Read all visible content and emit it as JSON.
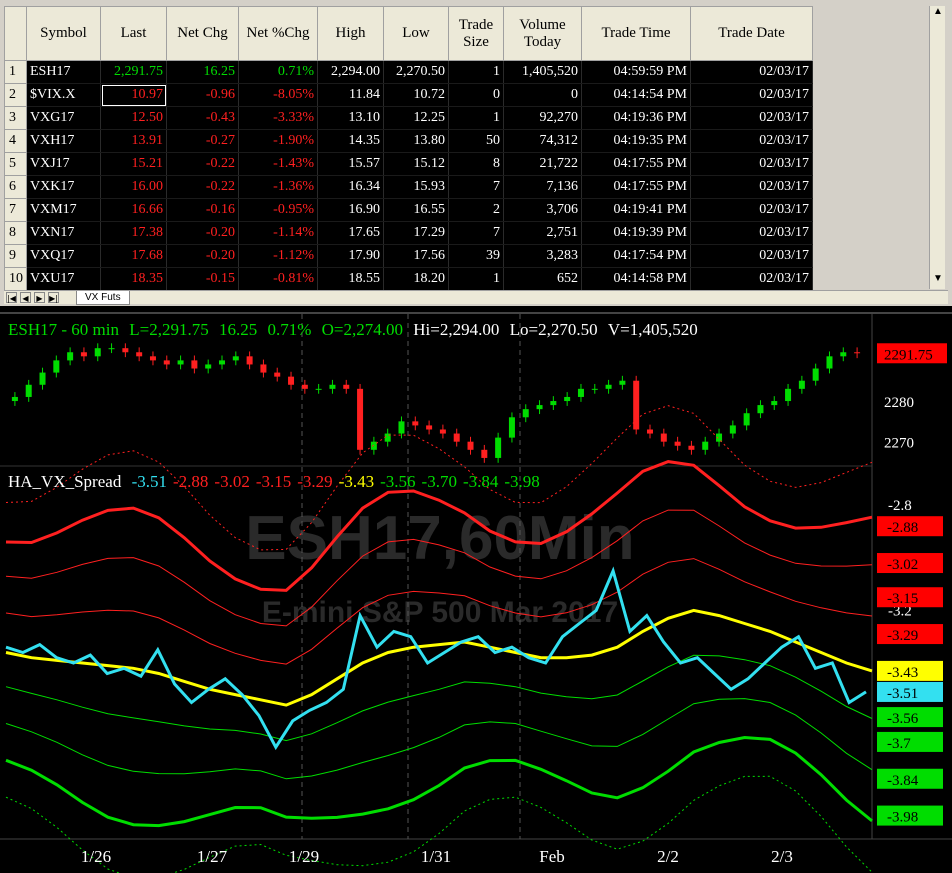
{
  "quote": {
    "headers": [
      "Symbol",
      "Last",
      "Net Chg",
      "Net %Chg",
      "High",
      "Low",
      "Trade Size",
      "Volume Today",
      "Trade Time",
      "Trade Date"
    ],
    "rows": [
      {
        "n": "1",
        "symbol": "ESH17",
        "last": "2,291.75",
        "chg": "16.25",
        "pct": "0.71%",
        "high": "2,294.00",
        "low": "2,270.50",
        "size": "1",
        "volume": "1,405,520",
        "time": "04:59:59 PM",
        "date": "02/03/17",
        "dir": "up"
      },
      {
        "n": "2",
        "symbol": "$VIX.X",
        "last": "10.97",
        "chg": "-0.96",
        "pct": "-8.05%",
        "high": "11.84",
        "low": "10.72",
        "size": "0",
        "volume": "0",
        "time": "04:14:54 PM",
        "date": "02/03/17",
        "dir": "dn"
      },
      {
        "n": "3",
        "symbol": "VXG17",
        "last": "12.50",
        "chg": "-0.43",
        "pct": "-3.33%",
        "high": "13.10",
        "low": "12.25",
        "size": "1",
        "volume": "92,270",
        "time": "04:19:36 PM",
        "date": "02/03/17",
        "dir": "dn"
      },
      {
        "n": "4",
        "symbol": "VXH17",
        "last": "13.91",
        "chg": "-0.27",
        "pct": "-1.90%",
        "high": "14.35",
        "low": "13.80",
        "size": "50",
        "volume": "74,312",
        "time": "04:19:35 PM",
        "date": "02/03/17",
        "dir": "dn"
      },
      {
        "n": "5",
        "symbol": "VXJ17",
        "last": "15.21",
        "chg": "-0.22",
        "pct": "-1.43%",
        "high": "15.57",
        "low": "15.12",
        "size": "8",
        "volume": "21,722",
        "time": "04:17:55 PM",
        "date": "02/03/17",
        "dir": "dn"
      },
      {
        "n": "6",
        "symbol": "VXK17",
        "last": "16.00",
        "chg": "-0.22",
        "pct": "-1.36%",
        "high": "16.34",
        "low": "15.93",
        "size": "7",
        "volume": "7,136",
        "time": "04:17:55 PM",
        "date": "02/03/17",
        "dir": "dn"
      },
      {
        "n": "7",
        "symbol": "VXM17",
        "last": "16.66",
        "chg": "-0.16",
        "pct": "-0.95%",
        "high": "16.90",
        "low": "16.55",
        "size": "2",
        "volume": "3,706",
        "time": "04:19:41 PM",
        "date": "02/03/17",
        "dir": "dn"
      },
      {
        "n": "8",
        "symbol": "VXN17",
        "last": "17.38",
        "chg": "-0.20",
        "pct": "-1.14%",
        "high": "17.65",
        "low": "17.29",
        "size": "7",
        "volume": "2,751",
        "time": "04:19:39 PM",
        "date": "02/03/17",
        "dir": "dn"
      },
      {
        "n": "9",
        "symbol": "VXQ17",
        "last": "17.68",
        "chg": "-0.20",
        "pct": "-1.12%",
        "high": "17.90",
        "low": "17.56",
        "size": "39",
        "volume": "3,283",
        "time": "04:17:54 PM",
        "date": "02/03/17",
        "dir": "dn"
      },
      {
        "n": "10",
        "symbol": "VXU17",
        "last": "18.35",
        "chg": "-0.15",
        "pct": "-0.81%",
        "high": "18.55",
        "low": "18.20",
        "size": "1",
        "volume": "652",
        "time": "04:14:58 PM",
        "date": "02/03/17",
        "dir": "dn"
      }
    ],
    "sheet_tab": "VX Futs",
    "nav_buttons": [
      "|◀",
      "◀",
      "▶",
      "▶|"
    ]
  },
  "chart_header": {
    "symbol": "ESH17 - 60 min",
    "last": "L=2,291.75",
    "chg": "16.25",
    "pct": "0.71%",
    "open": "O=2,274.00",
    "hi": "Hi=2,294.00",
    "lo": "Lo=2,270.50",
    "vol": "V=1,405,520"
  },
  "indicator_header": {
    "name": "HA_VX_Spread",
    "values": [
      {
        "text": "-3.51",
        "color": "#33e0f0"
      },
      {
        "text": "-2.88",
        "color": "#ff2020"
      },
      {
        "text": "-3.02",
        "color": "#ff2020"
      },
      {
        "text": "-3.15",
        "color": "#ff2020"
      },
      {
        "text": "-3.29",
        "color": "#ff2020"
      },
      {
        "text": "-3.43",
        "color": "#ffff00"
      },
      {
        "text": "-3.56",
        "color": "#00dd00"
      },
      {
        "text": "-3.70",
        "color": "#00dd00"
      },
      {
        "text": "-3.84",
        "color": "#00dd00"
      },
      {
        "text": "-3.98",
        "color": "#00dd00"
      }
    ]
  },
  "watermark": {
    "main": "ESH17,60Min",
    "sub": "E-mini S&P 500 Mar 2017"
  },
  "price_axis": {
    "tag": "2291.75",
    "ticks": [
      "2280",
      "2270"
    ]
  },
  "indicator_axis": {
    "ticks": [
      "-2.8",
      "-3.2",
      "-3.6"
    ],
    "tags": [
      {
        "text": "-2.88",
        "bg": "#ff0000",
        "fg": "#000"
      },
      {
        "text": "-3.02",
        "bg": "#ff0000",
        "fg": "#000"
      },
      {
        "text": "-3.15",
        "bg": "#ff0000",
        "fg": "#000"
      },
      {
        "text": "-3.29",
        "bg": "#ff0000",
        "fg": "#000"
      },
      {
        "text": "-3.43",
        "bg": "#ffff00",
        "fg": "#000"
      },
      {
        "text": "-3.51",
        "bg": "#33e0f0",
        "fg": "#000"
      },
      {
        "text": "-3.56",
        "bg": "#00dd00",
        "fg": "#000"
      },
      {
        "text": "-3.7",
        "bg": "#00dd00",
        "fg": "#000"
      },
      {
        "text": "-3.84",
        "bg": "#00dd00",
        "fg": "#000"
      },
      {
        "text": "-3.98",
        "bg": "#00dd00",
        "fg": "#000"
      }
    ]
  },
  "time_axis": [
    "1/26",
    "1/27",
    "1/29",
    "1/31",
    "Feb",
    "2/2",
    "2/3"
  ],
  "colors": {
    "up": "#00dd00",
    "down": "#ff2020",
    "spread": "#33e0f0",
    "mid": "#ffff00"
  },
  "chart_data": [
    {
      "type": "candlestick",
      "title": "ESH17 - 60 min",
      "series": [
        {
          "name": "ESH17",
          "close": [
            2281,
            2284,
            2287,
            2290,
            2292,
            2291,
            2293,
            2293,
            2292,
            2291,
            2290,
            2289,
            2290,
            2288,
            2289,
            2290,
            2291,
            2289,
            2287,
            2286,
            2284,
            2283,
            2283,
            2284,
            2283,
            2268,
            2270,
            2272,
            2275,
            2274,
            2273,
            2272,
            2270,
            2268,
            2266,
            2271,
            2276,
            2278,
            2279,
            2280,
            2281,
            2283,
            2283,
            2284,
            2285,
            2273,
            2272,
            2270,
            2269,
            2268,
            2270,
            2272,
            2274,
            2277,
            2279,
            2280,
            2283,
            2285,
            2288,
            2291,
            2292,
            2291.75
          ]
        }
      ],
      "ylim": [
        2265,
        2296
      ],
      "ticks": [
        "2280",
        "2270"
      ]
    },
    {
      "type": "line",
      "title": "HA_VX_Spread",
      "series": [
        {
          "name": "HA_VX_Spread",
          "values": [
            -3.34,
            -3.36,
            -3.33,
            -3.38,
            -3.4,
            -3.37,
            -3.44,
            -3.42,
            -3.45,
            -3.35,
            -3.48,
            -3.55,
            -3.5,
            -3.46,
            -3.52,
            -3.6,
            -3.72,
            -3.62,
            -3.58,
            -3.55,
            -3.5,
            -3.22,
            -3.34,
            -3.28,
            -3.3,
            -3.4,
            -3.36,
            -3.32,
            -3.3,
            -3.36,
            -3.34,
            -3.38,
            -3.4,
            -3.3,
            -3.25,
            -3.2,
            -3.05,
            -3.28,
            -3.22,
            -3.32,
            -3.4,
            -3.38,
            -3.44,
            -3.5,
            -3.46,
            -3.4,
            -3.34,
            -3.3,
            -3.42,
            -3.4,
            -3.55,
            -3.51
          ]
        },
        {
          "name": "-3.43",
          "values": [
            -3.36,
            -3.38,
            -3.39,
            -3.4,
            -3.41,
            -3.42,
            -3.44,
            -3.47,
            -3.5,
            -3.52,
            -3.54,
            -3.56,
            -3.52,
            -3.46,
            -3.4,
            -3.36,
            -3.34,
            -3.33,
            -3.32,
            -3.34,
            -3.36,
            -3.38,
            -3.38,
            -3.37,
            -3.34,
            -3.28,
            -3.23,
            -3.2,
            -3.22,
            -3.25,
            -3.28,
            -3.32,
            -3.36,
            -3.4,
            -3.43
          ]
        }
      ],
      "ticks": [
        "-2.8",
        "-3.2",
        "-3.6"
      ],
      "ylim": [
        -4.05,
        -2.75
      ]
    }
  ]
}
